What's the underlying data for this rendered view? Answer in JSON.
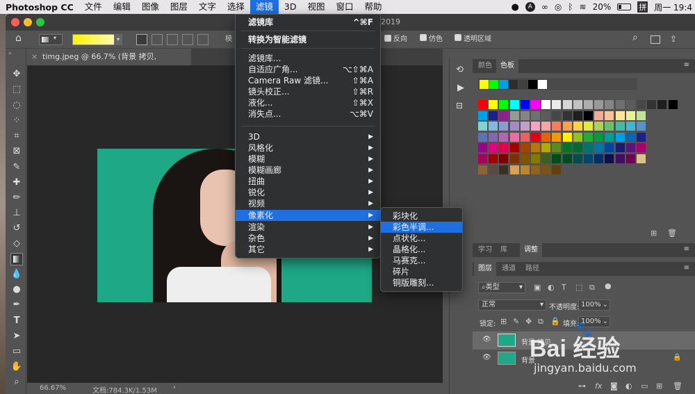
{
  "menubar": {
    "app_name": "Photoshop CC",
    "items": [
      "文件",
      "编辑",
      "图像",
      "图层",
      "文字",
      "选择",
      "滤镜",
      "3D",
      "视图",
      "窗口",
      "帮助"
    ],
    "active_item": "滤镜",
    "clock": "周一 19:4",
    "battery": "20%",
    "input_method": "拼"
  },
  "window": {
    "title_fragment": "2019"
  },
  "options_bar": {
    "mode_label": "模",
    "reverse_label": "反向",
    "dither_label": "仿色",
    "transparency_label": "透明区域"
  },
  "document": {
    "tab_title": "timg.jpeg @ 66.7% (背景 拷贝, RGB/8#) *",
    "zoom": "66.67%",
    "doc_info": "文档:784.3K/1.53M"
  },
  "filter_menu": {
    "items": [
      {
        "label": "滤镜库",
        "shortcut": "^⌘F",
        "bold": true
      },
      {
        "label": "转换为智能滤镜",
        "shortcut": "",
        "bold": true
      },
      {
        "label": "滤镜库...",
        "shortcut": ""
      },
      {
        "label": "自适应广角...",
        "shortcut": "⌥⇧⌘A"
      },
      {
        "label": "Camera Raw 滤镜...",
        "shortcut": "⇧⌘A"
      },
      {
        "label": "镜头校正...",
        "shortcut": "⇧⌘R"
      },
      {
        "label": "液化...",
        "shortcut": "⇧⌘X"
      },
      {
        "label": "消失点...",
        "shortcut": "⌥⌘V"
      },
      {
        "label": "3D",
        "submenu": true
      },
      {
        "label": "风格化",
        "submenu": true
      },
      {
        "label": "模糊",
        "submenu": true
      },
      {
        "label": "模糊画廊",
        "submenu": true
      },
      {
        "label": "扭曲",
        "submenu": true
      },
      {
        "label": "锐化",
        "submenu": true
      },
      {
        "label": "视频",
        "submenu": true
      },
      {
        "label": "像素化",
        "submenu": true,
        "highlighted": true
      },
      {
        "label": "渲染",
        "submenu": true
      },
      {
        "label": "杂色",
        "submenu": true
      },
      {
        "label": "其它",
        "submenu": true
      }
    ]
  },
  "pixelate_submenu": {
    "items": [
      "彩块化",
      "彩色半调...",
      "点状化...",
      "晶格化...",
      "马赛克...",
      "碎片",
      "铜版雕刻..."
    ],
    "highlighted_index": 1
  },
  "swatches_panel": {
    "tabs": [
      "颜色",
      "色板"
    ],
    "active_tab": "色板",
    "recent": [
      "#ffff00",
      "#00ff00",
      "#00a0e9",
      "#2d2d2d",
      "#404040",
      "#000000",
      "#ffffff"
    ],
    "rows": [
      [
        "#ff0000",
        "#ffff00",
        "#00ff00",
        "#00ffff",
        "#0000ff",
        "#ff00ff",
        "#ffffff",
        "#ebebeb",
        "#d6d6d6",
        "#c2c2c2",
        "#adadad",
        "#999999",
        "#858585",
        "#707070",
        "#5c5c5c",
        "#474747",
        "#333333",
        "#1f1f1f",
        "#000000",
        "#ff0000",
        "#ffff00",
        "#00ff00"
      ],
      [
        "#00a0e9",
        "#1f1f8c",
        "#8f1f8c",
        "#999999",
        "#858585",
        "#707070",
        "#5c5c5c",
        "#474747",
        "#333333",
        "#1f1f1f",
        "#000000",
        "#f7a896",
        "#f9c498",
        "#fde59b",
        "#e7f09b",
        "#c2e29a"
      ],
      [
        "#7ed3d6",
        "#7fb7e5",
        "#8e99d1",
        "#a38cc5",
        "#c69cc9",
        "#f3a4c3",
        "#f7a4a4",
        "#f57c5c",
        "#f6a24f",
        "#fdd33f",
        "#e4ea3f",
        "#a9d353",
        "#6cbf6a",
        "#45b9a5",
        "#3db8d6",
        "#5a91cf"
      ],
      [
        "#5f72b7",
        "#8466b0",
        "#b168b0",
        "#ed6da0",
        "#ee5f5f",
        "#e60012",
        "#eb6100",
        "#f39800",
        "#fff100",
        "#8fc31f",
        "#22ac38",
        "#009944",
        "#009e96",
        "#00a0e9",
        "#0068b7",
        "#1d2088"
      ],
      [
        "#920783",
        "#e4007f",
        "#e5004f",
        "#a40000",
        "#a84200",
        "#b7770b",
        "#b2a900",
        "#5d8a1e",
        "#077326",
        "#006934",
        "#00736d",
        "#0075a9",
        "#00479d",
        "#1a1c6e",
        "#5c1380",
        "#a8006c"
      ],
      [
        "#a5005b",
        "#a40000",
        "#7d0000",
        "#7f2e00",
        "#835300",
        "#827b00",
        "#3c6020",
        "#004d1a",
        "#004b23",
        "#004e4b",
        "#00466f",
        "#002e6c",
        "#110f4b",
        "#440d60",
        "#730054",
        "#d9c28d"
      ],
      [
        "#8c6239",
        "#594a42",
        "#3b2f2a",
        "#d4a15a",
        "#b58836",
        "#8f6421",
        "#7a5317",
        "#61400e"
      ]
    ]
  },
  "layers_panel": {
    "top_tabs": [
      "学习",
      "库",
      "调整"
    ],
    "active_top_tab": "调整",
    "tabs": [
      "图层",
      "通道",
      "路径"
    ],
    "active_tab": "图层",
    "filter_kind": "类型",
    "blend_mode": "正常",
    "opacity_label": "不透明度:",
    "opacity_value": "100%",
    "lock_label": "锁定:",
    "fill_label": "填充:",
    "fill_value": "100%",
    "layers": [
      {
        "name": "背景 拷贝",
        "selected": true,
        "locked": false
      },
      {
        "name": "背景",
        "selected": false,
        "locked": true
      }
    ]
  },
  "watermark": {
    "brand": "Bai 经验",
    "url": "jingyan.baidu.com"
  }
}
